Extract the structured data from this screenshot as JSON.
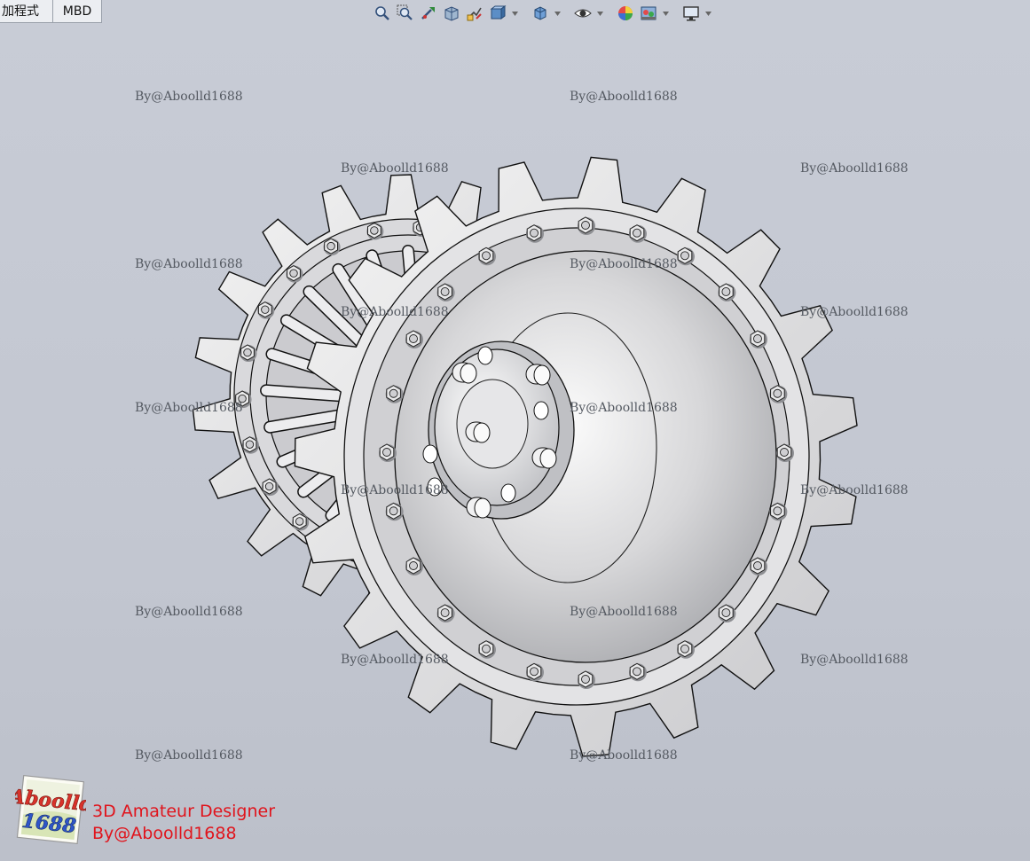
{
  "tabs": [
    {
      "label": "加程式"
    },
    {
      "label": "MBD"
    }
  ],
  "toolbar": {
    "icons": [
      "zoom-to-fit-icon",
      "zoom-area-icon",
      "previous-view-icon",
      "section-view-icon",
      "dynamic-annotation-icon",
      "view-orientation-icon",
      "display-style-icon",
      "hide-show-items-icon",
      "edit-appearance-icon",
      "apply-scene-icon",
      "view-settings-icon"
    ]
  },
  "watermark": "By@Aboolld1688",
  "brand": {
    "line1": "3D Amateur Designer",
    "line2": "By@Aboolld1688",
    "logo_text_top": "Aboolld",
    "logo_text_bottom": "1688",
    "color": "#e0141c"
  }
}
